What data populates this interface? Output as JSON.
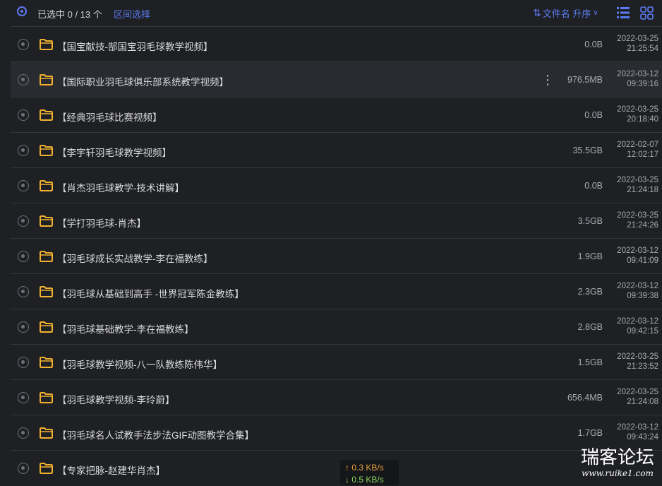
{
  "header": {
    "selection_text": "已选中 0 / 13 个",
    "range_select": "区间选择",
    "sort_label": "文件名 升序"
  },
  "colors": {
    "accent": "#5b7cf4",
    "folder": "#f2b230",
    "upload": "#e5a13b",
    "download": "#8bd35a"
  },
  "files": [
    {
      "name": "【国宝献技-郜国宝羽毛球教学视频】",
      "size": "0.0B",
      "date": "2022-03-25",
      "time": "21:25:54"
    },
    {
      "name": "【国际职业羽毛球俱乐部系统教学视频】",
      "size": "976.5MB",
      "date": "2022-03-12",
      "time": "09:39:16"
    },
    {
      "name": "【经典羽毛球比赛视频】",
      "size": "0.0B",
      "date": "2022-03-25",
      "time": "20:18:40"
    },
    {
      "name": "【李宇轩羽毛球教学视频】",
      "size": "35.5GB",
      "date": "2022-02-07",
      "time": "12:02:17"
    },
    {
      "name": "【肖杰羽毛球教学-技术讲解】",
      "size": "0.0B",
      "date": "2022-03-25",
      "time": "21:24:18"
    },
    {
      "name": "【学打羽毛球-肖杰】",
      "size": "3.5GB",
      "date": "2022-03-25",
      "time": "21:24:26"
    },
    {
      "name": "【羽毛球成长实战教学-李在福教练】",
      "size": "1.9GB",
      "date": "2022-03-12",
      "time": "09:41:09"
    },
    {
      "name": "【羽毛球从基础到高手 -世界冠军陈金教练】",
      "size": "2.3GB",
      "date": "2022-03-12",
      "time": "09:39:38"
    },
    {
      "name": "【羽毛球基础教学-李在福教练】",
      "size": "2.8GB",
      "date": "2022-03-12",
      "time": "09:42:15"
    },
    {
      "name": "【羽毛球教学视频-八一队教练陈伟华】",
      "size": "1.5GB",
      "date": "2022-03-25",
      "time": "21:23:52"
    },
    {
      "name": "【羽毛球教学视频-李玲蔚】",
      "size": "656.4MB",
      "date": "2022-03-25",
      "time": "21:24:08"
    },
    {
      "name": "【羽毛球名人试教手法步法GIF动图教学合集】",
      "size": "1.7GB",
      "date": "2022-03-12",
      "time": "09:43:24"
    },
    {
      "name": "【专家把脉-赵建华肖杰】",
      "size": "",
      "date": "",
      "time": ""
    }
  ],
  "hover_row": 1,
  "speed": {
    "up": "↑ 0.3 KB/s",
    "down": "↓ 0.5 KB/s"
  },
  "watermark": {
    "title": "瑞客论坛",
    "url": "www.ruike1.com"
  }
}
